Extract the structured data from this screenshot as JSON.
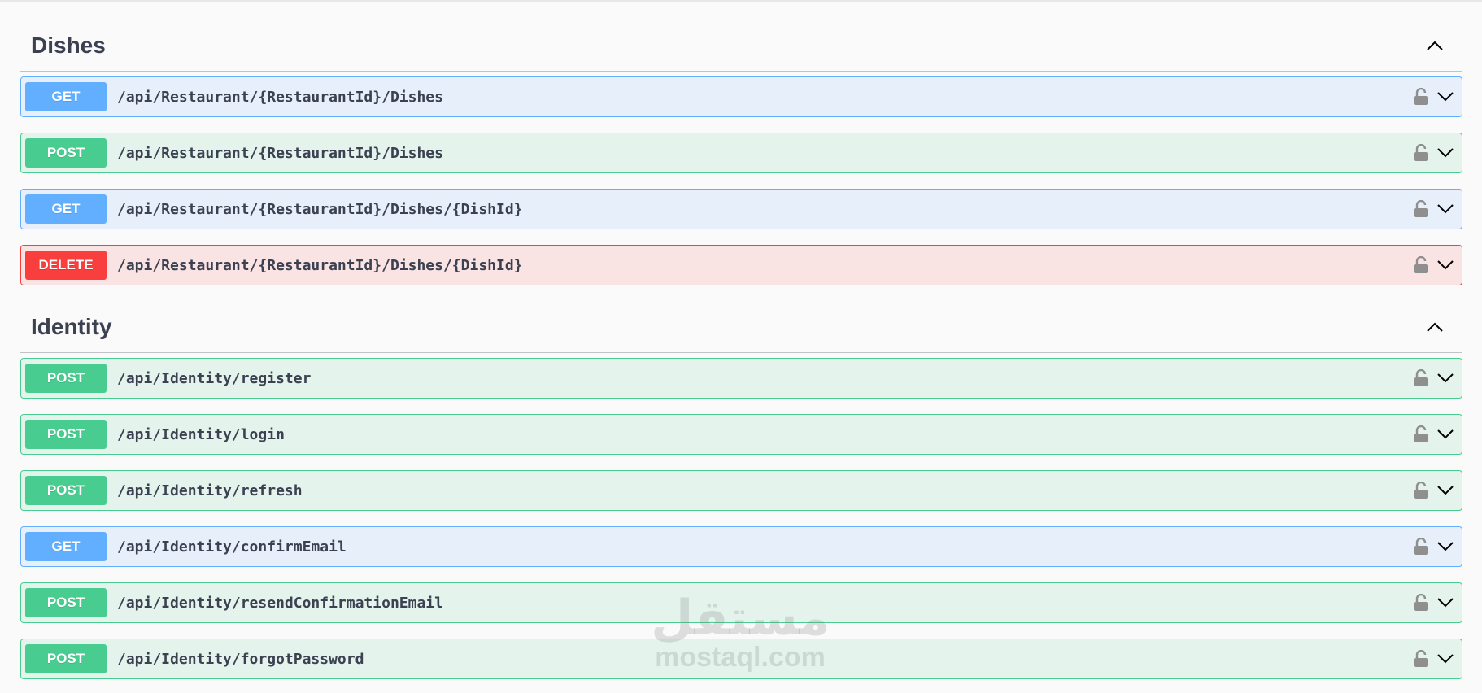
{
  "sections": [
    {
      "title": "Dishes",
      "operations": [
        {
          "method": "GET",
          "path": "/api/Restaurant/{RestaurantId}/Dishes"
        },
        {
          "method": "POST",
          "path": "/api/Restaurant/{RestaurantId}/Dishes"
        },
        {
          "method": "GET",
          "path": "/api/Restaurant/{RestaurantId}/Dishes/{DishId}"
        },
        {
          "method": "DELETE",
          "path": "/api/Restaurant/{RestaurantId}/Dishes/{DishId}"
        }
      ]
    },
    {
      "title": "Identity",
      "operations": [
        {
          "method": "POST",
          "path": "/api/Identity/register"
        },
        {
          "method": "POST",
          "path": "/api/Identity/login"
        },
        {
          "method": "POST",
          "path": "/api/Identity/refresh"
        },
        {
          "method": "GET",
          "path": "/api/Identity/confirmEmail"
        },
        {
          "method": "POST",
          "path": "/api/Identity/resendConfirmationEmail"
        },
        {
          "method": "POST",
          "path": "/api/Identity/forgotPassword"
        }
      ]
    }
  ],
  "icons": {
    "collapse": "chevron-up-icon",
    "lock": "lock-icon",
    "expand": "chevron-down-icon"
  },
  "colors": {
    "get": "#61affe",
    "post": "#49cc90",
    "delete": "#f93e3e",
    "text": "#3b4151"
  },
  "watermark": {
    "arabic": "مستقل",
    "latin": "mostaql.com"
  }
}
